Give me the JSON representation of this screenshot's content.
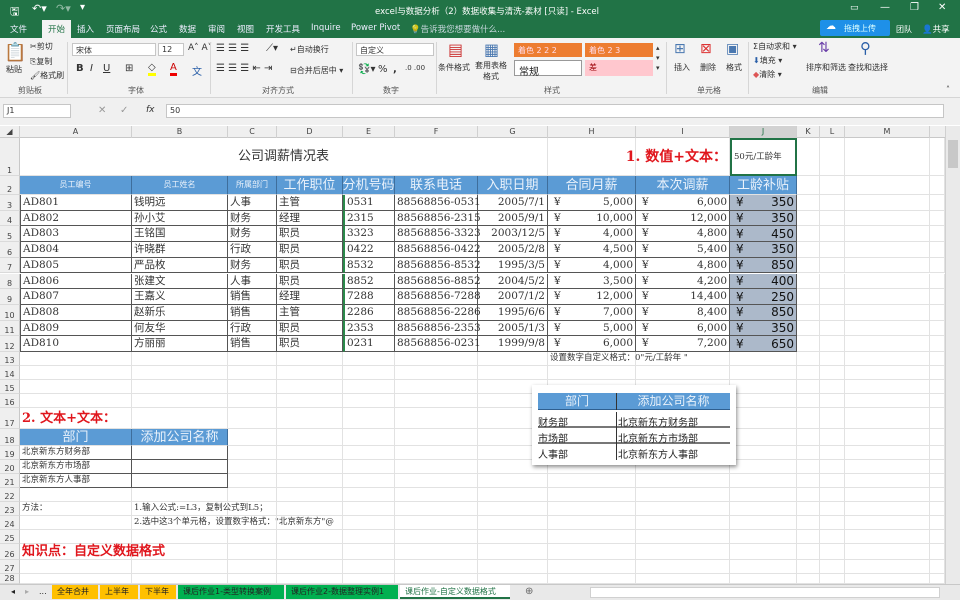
{
  "titlebar": {
    "title": "excel与数据分析（2）数据收集与清洗-素材 [只读] - Excel",
    "upload": "拖拽上传",
    "user": "团队",
    "share": "共享"
  },
  "ribbon_tabs": [
    "文件",
    "开始",
    "插入",
    "页面布局",
    "公式",
    "数据",
    "审阅",
    "视图",
    "开发工具",
    "Inquire",
    "Power Pivot"
  ],
  "tell_me": "告诉我您想要做什么...",
  "ribbon": {
    "clipboard": {
      "paste": "粘贴",
      "cut": "剪切",
      "copy": "复制",
      "painter": "格式刷",
      "label": "剪贴板"
    },
    "font": {
      "name": "宋体",
      "size": "12",
      "bold": "B",
      "italic": "I",
      "underline": "U",
      "label": "字体"
    },
    "alignment": {
      "wrap": "自动换行",
      "merge": "合并后居中",
      "label": "对齐方式"
    },
    "number": {
      "format": "自定义",
      "percent": "%",
      "comma": ",",
      "label": "数字"
    },
    "styles": {
      "conditional": "条件格式",
      "table": "套用表格格式",
      "s1": "着色 2 2 2",
      "s2": "着色 2 3",
      "normal": "常规",
      "bad": "差",
      "label": "样式"
    },
    "cells": {
      "insert": "插入",
      "delete": "删除",
      "format": "格式",
      "label": "单元格"
    },
    "editing": {
      "autosum": "自动求和",
      "fill": "填充",
      "clear": "清除",
      "sort": "排序和筛选",
      "find": "查找和选择",
      "label": "编辑"
    }
  },
  "formula_bar": {
    "name_box": "J1",
    "value": "50"
  },
  "columns": [
    "A",
    "B",
    "C",
    "D",
    "E",
    "F",
    "G",
    "H",
    "I",
    "J",
    "K",
    "L",
    "M"
  ],
  "sheet": {
    "title": "公司调薪情况表",
    "label1": "1. 数值+文本：",
    "j1": "50元/工龄年",
    "headers": [
      "员工编号",
      "员工姓名",
      "所属部门",
      "工作职位",
      "分机号码",
      "联系电话",
      "入职日期",
      "合同月薪",
      "本次调薪",
      "工龄补贴"
    ],
    "currency": "¥",
    "employees": [
      [
        "AD801",
        "钱明远",
        "人事",
        "主管",
        "0531",
        "88568856-0531",
        "2005/7/1",
        "5,000",
        "6,000",
        "350"
      ],
      [
        "AD802",
        "孙小艾",
        "财务",
        "经理",
        "2315",
        "88568856-2315",
        "2005/9/1",
        "10,000",
        "12,000",
        "350"
      ],
      [
        "AD803",
        "王铭国",
        "财务",
        "职员",
        "3323",
        "88568856-3323",
        "2003/12/5",
        "4,000",
        "4,800",
        "450"
      ],
      [
        "AD804",
        "许晓群",
        "行政",
        "职员",
        "0422",
        "88568856-0422",
        "2005/2/8",
        "4,500",
        "5,400",
        "350"
      ],
      [
        "AD805",
        "严品枚",
        "财务",
        "职员",
        "8532",
        "88568856-8532",
        "1995/3/5",
        "4,000",
        "4,800",
        "850"
      ],
      [
        "AD806",
        "张建文",
        "人事",
        "职员",
        "8852",
        "88568856-8852",
        "2004/5/2",
        "3,500",
        "4,200",
        "400"
      ],
      [
        "AD807",
        "王嘉义",
        "销售",
        "经理",
        "7288",
        "88568856-7288",
        "2007/1/2",
        "12,000",
        "14,400",
        "250"
      ],
      [
        "AD808",
        "赵新乐",
        "销售",
        "主管",
        "2286",
        "88568856-2286",
        "1995/6/6",
        "7,000",
        "8,400",
        "850"
      ],
      [
        "AD809",
        "何友华",
        "行政",
        "职员",
        "2353",
        "88568856-2353",
        "2005/1/3",
        "5,000",
        "6,000",
        "350"
      ],
      [
        "AD810",
        "方丽丽",
        "销售",
        "职员",
        "0231",
        "88568856-0231",
        "1999/9/8",
        "6,000",
        "7,200",
        "650"
      ]
    ],
    "note13": "设置数字自定义格式：0\"元/工龄年 \"",
    "label2": "2. 文本+文本：",
    "dept_headers": [
      "部门",
      "添加公司名称"
    ],
    "dept_rows": [
      "北京新东方财务部",
      "北京新东方市场部",
      "北京新东方人事部"
    ],
    "method_label": "方法：",
    "method1": "1.输入公式:=L3，复制公式到L5；",
    "method2": "2.选中这3个单元格，设置数字格式：\"北京新东方\"@",
    "knowledge": "知识点：自定义数据格式"
  },
  "picture": {
    "headers": [
      "部门",
      "添加公司名称"
    ],
    "rows": [
      [
        "财务部",
        "北京新东方财务部"
      ],
      [
        "市场部",
        "北京新东方市场部"
      ],
      [
        "人事部",
        "北京新东方人事部"
      ]
    ]
  },
  "sheet_tabs": [
    {
      "label": "全年合并",
      "color": "#ffc000"
    },
    {
      "label": "上半年",
      "color": "#ffc000"
    },
    {
      "label": "下半年",
      "color": "#ffc000"
    },
    {
      "label": "课后作业1-类型转换案例",
      "color": "#00b050"
    },
    {
      "label": "课后作业2-数据整理实例1",
      "color": "#00b050"
    },
    {
      "label": "课后作业-自定义数据格式",
      "color": "#ffffff"
    }
  ],
  "tabs_ellipsis": "..."
}
